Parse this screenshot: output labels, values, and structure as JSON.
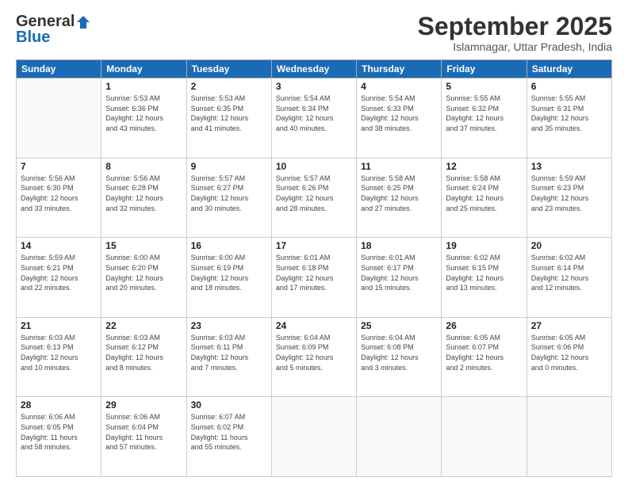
{
  "header": {
    "logo_line1": "General",
    "logo_line2": "Blue",
    "month_title": "September 2025",
    "location": "Islamnagar, Uttar Pradesh, India"
  },
  "days_of_week": [
    "Sunday",
    "Monday",
    "Tuesday",
    "Wednesday",
    "Thursday",
    "Friday",
    "Saturday"
  ],
  "weeks": [
    [
      {
        "num": "",
        "info": ""
      },
      {
        "num": "1",
        "info": "Sunrise: 5:53 AM\nSunset: 6:36 PM\nDaylight: 12 hours\nand 43 minutes."
      },
      {
        "num": "2",
        "info": "Sunrise: 5:53 AM\nSunset: 6:35 PM\nDaylight: 12 hours\nand 41 minutes."
      },
      {
        "num": "3",
        "info": "Sunrise: 5:54 AM\nSunset: 6:34 PM\nDaylight: 12 hours\nand 40 minutes."
      },
      {
        "num": "4",
        "info": "Sunrise: 5:54 AM\nSunset: 6:33 PM\nDaylight: 12 hours\nand 38 minutes."
      },
      {
        "num": "5",
        "info": "Sunrise: 5:55 AM\nSunset: 6:32 PM\nDaylight: 12 hours\nand 37 minutes."
      },
      {
        "num": "6",
        "info": "Sunrise: 5:55 AM\nSunset: 6:31 PM\nDaylight: 12 hours\nand 35 minutes."
      }
    ],
    [
      {
        "num": "7",
        "info": "Sunrise: 5:56 AM\nSunset: 6:30 PM\nDaylight: 12 hours\nand 33 minutes."
      },
      {
        "num": "8",
        "info": "Sunrise: 5:56 AM\nSunset: 6:28 PM\nDaylight: 12 hours\nand 32 minutes."
      },
      {
        "num": "9",
        "info": "Sunrise: 5:57 AM\nSunset: 6:27 PM\nDaylight: 12 hours\nand 30 minutes."
      },
      {
        "num": "10",
        "info": "Sunrise: 5:57 AM\nSunset: 6:26 PM\nDaylight: 12 hours\nand 28 minutes."
      },
      {
        "num": "11",
        "info": "Sunrise: 5:58 AM\nSunset: 6:25 PM\nDaylight: 12 hours\nand 27 minutes."
      },
      {
        "num": "12",
        "info": "Sunrise: 5:58 AM\nSunset: 6:24 PM\nDaylight: 12 hours\nand 25 minutes."
      },
      {
        "num": "13",
        "info": "Sunrise: 5:59 AM\nSunset: 6:23 PM\nDaylight: 12 hours\nand 23 minutes."
      }
    ],
    [
      {
        "num": "14",
        "info": "Sunrise: 5:59 AM\nSunset: 6:21 PM\nDaylight: 12 hours\nand 22 minutes."
      },
      {
        "num": "15",
        "info": "Sunrise: 6:00 AM\nSunset: 6:20 PM\nDaylight: 12 hours\nand 20 minutes."
      },
      {
        "num": "16",
        "info": "Sunrise: 6:00 AM\nSunset: 6:19 PM\nDaylight: 12 hours\nand 18 minutes."
      },
      {
        "num": "17",
        "info": "Sunrise: 6:01 AM\nSunset: 6:18 PM\nDaylight: 12 hours\nand 17 minutes."
      },
      {
        "num": "18",
        "info": "Sunrise: 6:01 AM\nSunset: 6:17 PM\nDaylight: 12 hours\nand 15 minutes."
      },
      {
        "num": "19",
        "info": "Sunrise: 6:02 AM\nSunset: 6:15 PM\nDaylight: 12 hours\nand 13 minutes."
      },
      {
        "num": "20",
        "info": "Sunrise: 6:02 AM\nSunset: 6:14 PM\nDaylight: 12 hours\nand 12 minutes."
      }
    ],
    [
      {
        "num": "21",
        "info": "Sunrise: 6:03 AM\nSunset: 6:13 PM\nDaylight: 12 hours\nand 10 minutes."
      },
      {
        "num": "22",
        "info": "Sunrise: 6:03 AM\nSunset: 6:12 PM\nDaylight: 12 hours\nand 8 minutes."
      },
      {
        "num": "23",
        "info": "Sunrise: 6:03 AM\nSunset: 6:11 PM\nDaylight: 12 hours\nand 7 minutes."
      },
      {
        "num": "24",
        "info": "Sunrise: 6:04 AM\nSunset: 6:09 PM\nDaylight: 12 hours\nand 5 minutes."
      },
      {
        "num": "25",
        "info": "Sunrise: 6:04 AM\nSunset: 6:08 PM\nDaylight: 12 hours\nand 3 minutes."
      },
      {
        "num": "26",
        "info": "Sunrise: 6:05 AM\nSunset: 6:07 PM\nDaylight: 12 hours\nand 2 minutes."
      },
      {
        "num": "27",
        "info": "Sunrise: 6:05 AM\nSunset: 6:06 PM\nDaylight: 12 hours\nand 0 minutes."
      }
    ],
    [
      {
        "num": "28",
        "info": "Sunrise: 6:06 AM\nSunset: 6:05 PM\nDaylight: 11 hours\nand 58 minutes."
      },
      {
        "num": "29",
        "info": "Sunrise: 6:06 AM\nSunset: 6:04 PM\nDaylight: 11 hours\nand 57 minutes."
      },
      {
        "num": "30",
        "info": "Sunrise: 6:07 AM\nSunset: 6:02 PM\nDaylight: 11 hours\nand 55 minutes."
      },
      {
        "num": "",
        "info": ""
      },
      {
        "num": "",
        "info": ""
      },
      {
        "num": "",
        "info": ""
      },
      {
        "num": "",
        "info": ""
      }
    ]
  ]
}
